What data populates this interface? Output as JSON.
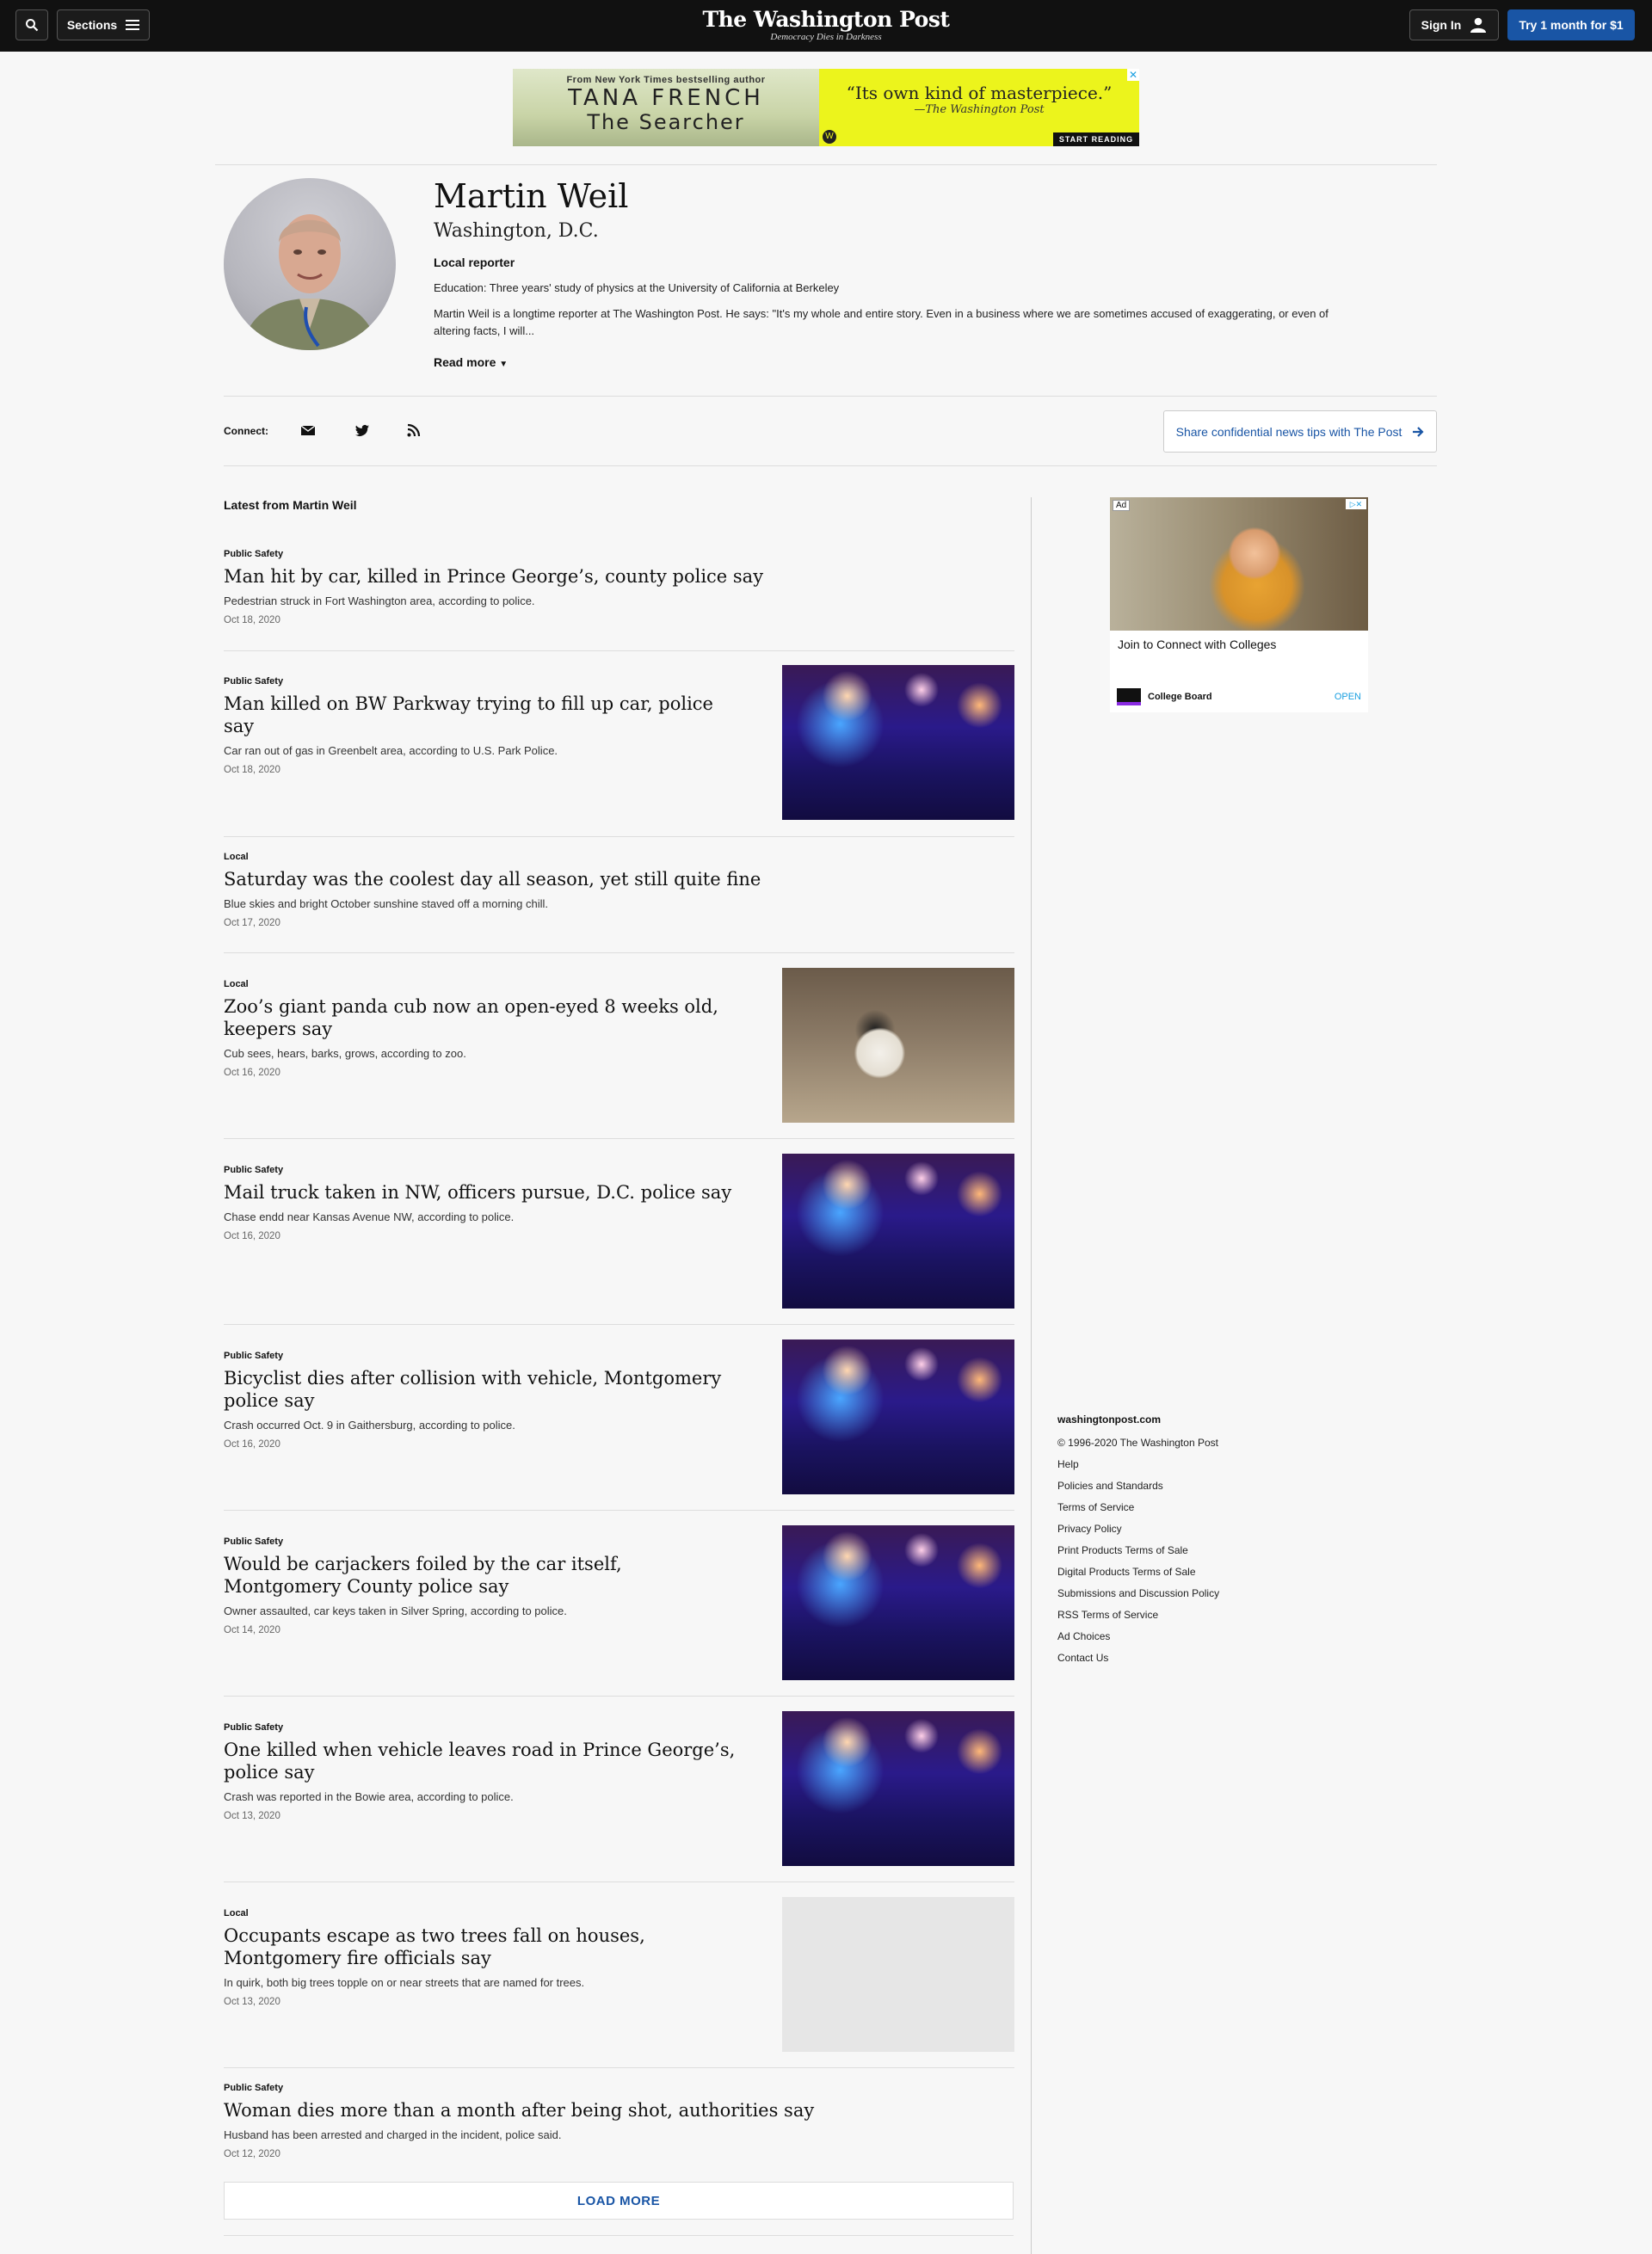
{
  "header": {
    "sections_label": "Sections",
    "logo_title": "The Washington Post",
    "logo_tagline": "Democracy Dies in Darkness",
    "signin_label": "Sign In",
    "subscribe_label": "Try 1 month for $1"
  },
  "top_ad": {
    "from_line": "From New York Times bestselling author",
    "author": "TANA FRENCH",
    "book": "The Searcher",
    "quote": "“Its own kind of masterpiece.”",
    "attribution": "—The Washington Post",
    "cta": "START READING"
  },
  "author": {
    "name": "Martin Weil",
    "location": "Washington, D.C.",
    "role": "Local reporter",
    "education": "Education: Three years' study of physics at the University of California at Berkeley",
    "bio": "Martin Weil is a longtime reporter at The Washington Post. He says: \"It's my whole and entire story. Even in a business where we are sometimes accused of exaggerating, or even of altering facts, I will...",
    "read_more": "Read more"
  },
  "connect": {
    "label": "Connect:",
    "icons": [
      "email-icon",
      "twitter-icon",
      "rss-icon"
    ],
    "tips_label": "Share confidential news tips with The Post"
  },
  "feed": {
    "title": "Latest from Martin Weil",
    "stories": [
      {
        "kicker": "Public Safety",
        "headline": "Man hit by car, killed in Prince George’s, county police say",
        "blurb": "Pedestrian struck in Fort Washington area, according to police.",
        "date": "Oct 18, 2020",
        "image": "none"
      },
      {
        "kicker": "Public Safety",
        "headline": "Man killed on BW Parkway trying to fill up car, police say",
        "blurb": "Car ran out of gas in Greenbelt area, according to U.S. Park Police.",
        "date": "Oct 18, 2020",
        "image": "police-lights"
      },
      {
        "kicker": "Local",
        "headline": "Saturday was the coolest day all season, yet still quite fine",
        "blurb": "Blue skies and bright October sunshine staved off a morning chill.",
        "date": "Oct 17, 2020",
        "image": "none"
      },
      {
        "kicker": "Local",
        "headline": "Zoo’s giant panda cub now an open-eyed 8 weeks old, keepers say",
        "blurb": "Cub sees, hears, barks, grows, according to zoo.",
        "date": "Oct 16, 2020",
        "image": "panda-cub"
      },
      {
        "kicker": "Public Safety",
        "headline": "Mail truck taken in NW, officers pursue, D.C. police say",
        "blurb": "Chase endd near Kansas Avenue NW, according to police.",
        "date": "Oct 16, 2020",
        "image": "police-lights"
      },
      {
        "kicker": "Public Safety",
        "headline": "Bicyclist dies after collision with vehicle, Montgomery police say",
        "blurb": "Crash occurred Oct. 9 in Gaithersburg, according to police.",
        "date": "Oct 16, 2020",
        "image": "police-lights"
      },
      {
        "kicker": "Public Safety",
        "headline": "Would be carjackers foiled by the car itself, Montgomery County police say",
        "blurb": "Owner assaulted, car keys taken in Silver Spring, according to police.",
        "date": "Oct 14, 2020",
        "image": "police-lights"
      },
      {
        "kicker": "Public Safety",
        "headline": "One killed when vehicle leaves road in Prince George’s, police say",
        "blurb": "Crash was reported in the Bowie area, according to police.",
        "date": "Oct 13, 2020",
        "image": "police-lights"
      },
      {
        "kicker": "Local",
        "headline": "Occupants escape as two trees fall on houses, Montgomery fire officials say",
        "blurb": "In quirk, both big trees topple on or near streets that are named for trees.",
        "date": "Oct 13, 2020",
        "image": "placeholder"
      },
      {
        "kicker": "Public Safety",
        "headline": "Woman dies more than a month after being shot, authorities say",
        "blurb": "Husband has been arrested and charged in the incident, police said.",
        "date": "Oct 12, 2020",
        "image": "none"
      }
    ],
    "load_more": "LOAD MORE"
  },
  "side_ad": {
    "ad_label": "Ad",
    "title": "Join to Connect with Colleges",
    "advertiser": "College Board",
    "cta": "OPEN"
  },
  "footer": {
    "site": "washingtonpost.com",
    "items": [
      "© 1996-2020 The Washington Post",
      "Help",
      "Policies and Standards",
      "Terms of Service",
      "Privacy Policy",
      "Print Products Terms of Sale",
      "Digital Products Terms of Sale",
      "Submissions and Discussion Policy",
      "RSS Terms of Service",
      "Ad Choices",
      "Contact Us"
    ]
  }
}
